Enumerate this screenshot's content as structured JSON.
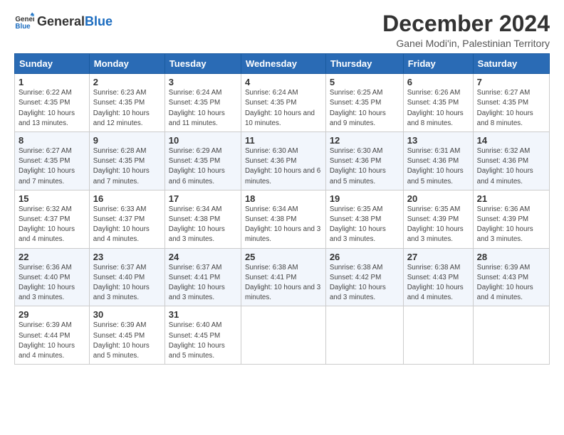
{
  "header": {
    "logo_general": "General",
    "logo_blue": "Blue",
    "title": "December 2024",
    "subtitle": "Ganei Modi'in, Palestinian Territory"
  },
  "days_of_week": [
    "Sunday",
    "Monday",
    "Tuesday",
    "Wednesday",
    "Thursday",
    "Friday",
    "Saturday"
  ],
  "weeks": [
    [
      {
        "day": "1",
        "sunrise": "6:22 AM",
        "sunset": "4:35 PM",
        "daylight": "10 hours and 13 minutes."
      },
      {
        "day": "2",
        "sunrise": "6:23 AM",
        "sunset": "4:35 PM",
        "daylight": "10 hours and 12 minutes."
      },
      {
        "day": "3",
        "sunrise": "6:24 AM",
        "sunset": "4:35 PM",
        "daylight": "10 hours and 11 minutes."
      },
      {
        "day": "4",
        "sunrise": "6:24 AM",
        "sunset": "4:35 PM",
        "daylight": "10 hours and 10 minutes."
      },
      {
        "day": "5",
        "sunrise": "6:25 AM",
        "sunset": "4:35 PM",
        "daylight": "10 hours and 9 minutes."
      },
      {
        "day": "6",
        "sunrise": "6:26 AM",
        "sunset": "4:35 PM",
        "daylight": "10 hours and 8 minutes."
      },
      {
        "day": "7",
        "sunrise": "6:27 AM",
        "sunset": "4:35 PM",
        "daylight": "10 hours and 8 minutes."
      }
    ],
    [
      {
        "day": "8",
        "sunrise": "6:27 AM",
        "sunset": "4:35 PM",
        "daylight": "10 hours and 7 minutes."
      },
      {
        "day": "9",
        "sunrise": "6:28 AM",
        "sunset": "4:35 PM",
        "daylight": "10 hours and 7 minutes."
      },
      {
        "day": "10",
        "sunrise": "6:29 AM",
        "sunset": "4:35 PM",
        "daylight": "10 hours and 6 minutes."
      },
      {
        "day": "11",
        "sunrise": "6:30 AM",
        "sunset": "4:36 PM",
        "daylight": "10 hours and 6 minutes."
      },
      {
        "day": "12",
        "sunrise": "6:30 AM",
        "sunset": "4:36 PM",
        "daylight": "10 hours and 5 minutes."
      },
      {
        "day": "13",
        "sunrise": "6:31 AM",
        "sunset": "4:36 PM",
        "daylight": "10 hours and 5 minutes."
      },
      {
        "day": "14",
        "sunrise": "6:32 AM",
        "sunset": "4:36 PM",
        "daylight": "10 hours and 4 minutes."
      }
    ],
    [
      {
        "day": "15",
        "sunrise": "6:32 AM",
        "sunset": "4:37 PM",
        "daylight": "10 hours and 4 minutes."
      },
      {
        "day": "16",
        "sunrise": "6:33 AM",
        "sunset": "4:37 PM",
        "daylight": "10 hours and 4 minutes."
      },
      {
        "day": "17",
        "sunrise": "6:34 AM",
        "sunset": "4:38 PM",
        "daylight": "10 hours and 3 minutes."
      },
      {
        "day": "18",
        "sunrise": "6:34 AM",
        "sunset": "4:38 PM",
        "daylight": "10 hours and 3 minutes."
      },
      {
        "day": "19",
        "sunrise": "6:35 AM",
        "sunset": "4:38 PM",
        "daylight": "10 hours and 3 minutes."
      },
      {
        "day": "20",
        "sunrise": "6:35 AM",
        "sunset": "4:39 PM",
        "daylight": "10 hours and 3 minutes."
      },
      {
        "day": "21",
        "sunrise": "6:36 AM",
        "sunset": "4:39 PM",
        "daylight": "10 hours and 3 minutes."
      }
    ],
    [
      {
        "day": "22",
        "sunrise": "6:36 AM",
        "sunset": "4:40 PM",
        "daylight": "10 hours and 3 minutes."
      },
      {
        "day": "23",
        "sunrise": "6:37 AM",
        "sunset": "4:40 PM",
        "daylight": "10 hours and 3 minutes."
      },
      {
        "day": "24",
        "sunrise": "6:37 AM",
        "sunset": "4:41 PM",
        "daylight": "10 hours and 3 minutes."
      },
      {
        "day": "25",
        "sunrise": "6:38 AM",
        "sunset": "4:41 PM",
        "daylight": "10 hours and 3 minutes."
      },
      {
        "day": "26",
        "sunrise": "6:38 AM",
        "sunset": "4:42 PM",
        "daylight": "10 hours and 3 minutes."
      },
      {
        "day": "27",
        "sunrise": "6:38 AM",
        "sunset": "4:43 PM",
        "daylight": "10 hours and 4 minutes."
      },
      {
        "day": "28",
        "sunrise": "6:39 AM",
        "sunset": "4:43 PM",
        "daylight": "10 hours and 4 minutes."
      }
    ],
    [
      {
        "day": "29",
        "sunrise": "6:39 AM",
        "sunset": "4:44 PM",
        "daylight": "10 hours and 4 minutes."
      },
      {
        "day": "30",
        "sunrise": "6:39 AM",
        "sunset": "4:45 PM",
        "daylight": "10 hours and 5 minutes."
      },
      {
        "day": "31",
        "sunrise": "6:40 AM",
        "sunset": "4:45 PM",
        "daylight": "10 hours and 5 minutes."
      },
      null,
      null,
      null,
      null
    ]
  ]
}
